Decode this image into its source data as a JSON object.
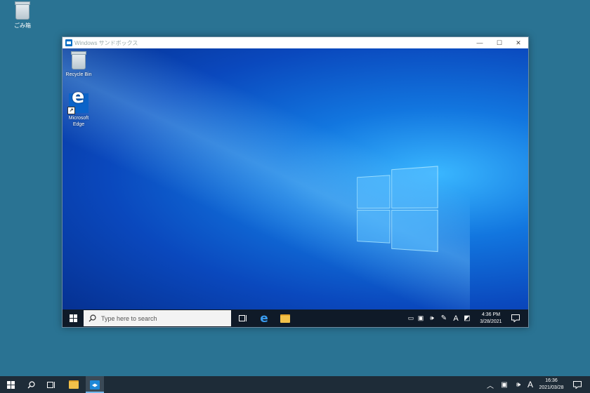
{
  "host_desktop": {
    "recycle_bin_label": "ごみ箱"
  },
  "window": {
    "title": "Windows サンドボックス",
    "minimize_glyph": "—",
    "maximize_glyph": "☐",
    "close_glyph": "✕"
  },
  "sandbox_desktop": {
    "icons": [
      {
        "label": "Recycle Bin"
      },
      {
        "label": "Microsoft Edge"
      }
    ]
  },
  "sandbox_taskbar": {
    "search_placeholder": "Type here to search",
    "ime_indicator": "A",
    "time": "4:36 PM",
    "date": "3/28/2021"
  },
  "host_taskbar": {
    "ime_indicator": "A",
    "time": "16:36",
    "date": "2021/03/28"
  }
}
